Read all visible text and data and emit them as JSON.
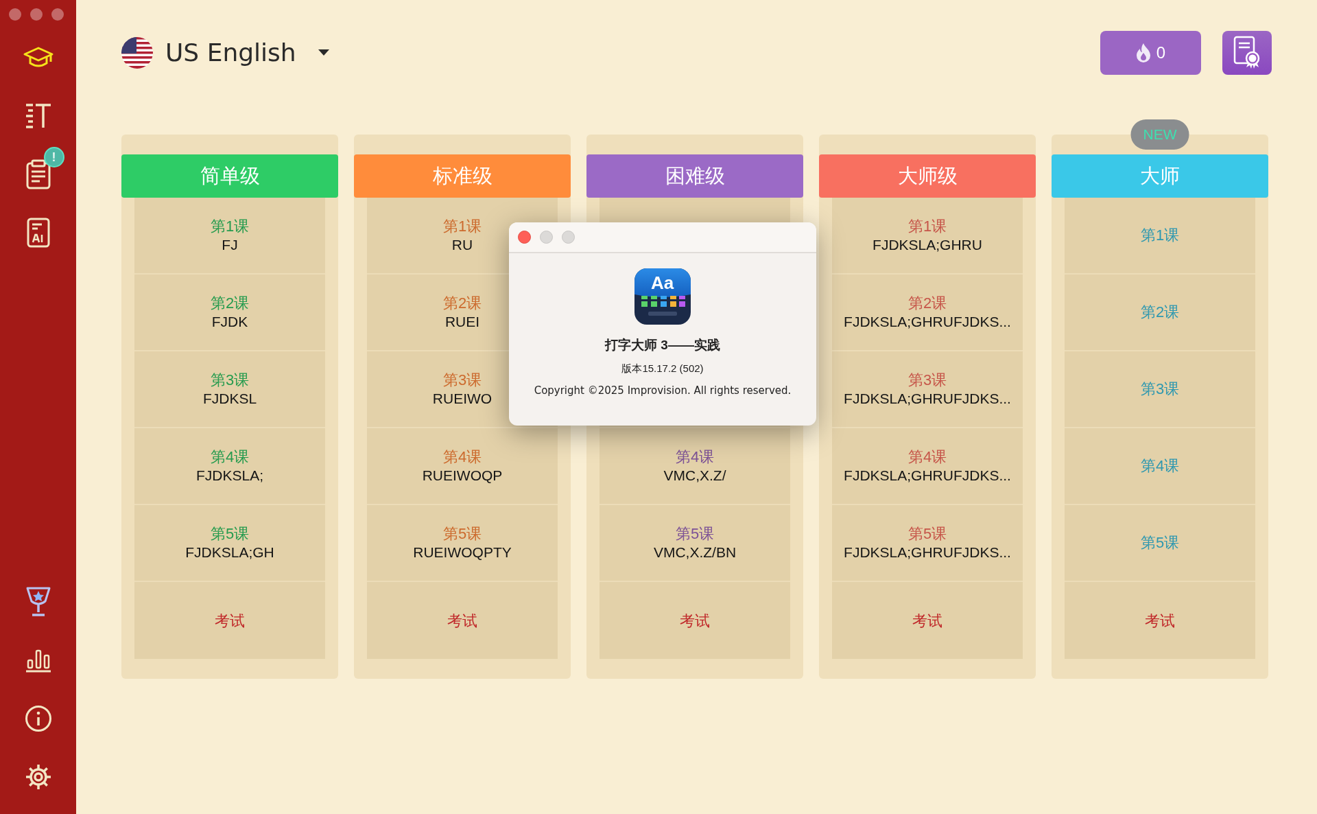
{
  "sidebar": {
    "items": [
      {
        "selected": true
      },
      {
        "selected": false
      },
      {
        "selected": false,
        "badge": "!"
      },
      {
        "selected": false
      },
      {
        "selected": false
      },
      {
        "selected": false
      },
      {
        "selected": false
      },
      {
        "selected": false
      }
    ]
  },
  "language": {
    "label": "US English"
  },
  "streak": {
    "count": "0"
  },
  "levels": [
    {
      "title": "简单级",
      "color": "#2ecc66",
      "lessons": [
        {
          "title": "第1课",
          "keys": "FJ"
        },
        {
          "title": "第2课",
          "keys": "FJDK"
        },
        {
          "title": "第3课",
          "keys": "FJDKSL"
        },
        {
          "title": "第4课",
          "keys": "FJDKSLA;"
        },
        {
          "title": "第5课",
          "keys": "FJDKSLA;GH"
        }
      ],
      "exam": "考试"
    },
    {
      "title": "标准级",
      "color": "#ff8c3b",
      "lessons": [
        {
          "title": "第1课",
          "keys": "RU"
        },
        {
          "title": "第2课",
          "keys": "RUEI"
        },
        {
          "title": "第3课",
          "keys": "RUEIWO"
        },
        {
          "title": "第4课",
          "keys": "RUEIWOQP"
        },
        {
          "title": "第5课",
          "keys": "RUEIWOQPTY"
        }
      ],
      "exam": "考试"
    },
    {
      "title": "困难级",
      "color": "#9b6ac6",
      "lessons": [
        {
          "covered": true
        },
        {
          "title": "第4课",
          "keys": "VMC,X.Z/"
        },
        {
          "title": "第5课",
          "keys": "VMC,X.Z/BN"
        }
      ],
      "exam": "考试"
    },
    {
      "title": "大师级",
      "color": "#f87060",
      "lessons": [
        {
          "title": "第1课",
          "keys": "FJDKSLA;GHRU"
        },
        {
          "title": "第2课",
          "keys": "FJDKSLA;GHRUFJDKS..."
        },
        {
          "title": "第3课",
          "keys": "FJDKSLA;GHRUFJDKS..."
        },
        {
          "title": "第4课",
          "keys": "FJDKSLA;GHRUFJDKS..."
        },
        {
          "title": "第5课",
          "keys": "FJDKSLA;GHRUFJDKS..."
        }
      ],
      "exam": "考试"
    },
    {
      "title": "大师",
      "color": "#3ac8e8",
      "badge": "NEW",
      "lessons": [
        {
          "title": "第1课"
        },
        {
          "title": "第2课"
        },
        {
          "title": "第3课"
        },
        {
          "title": "第4课"
        },
        {
          "title": "第5课"
        }
      ],
      "exam": "考试"
    }
  ],
  "dialog": {
    "icon_text": "Aa",
    "app_name": "打字大师 3——实践",
    "version": "版本15.17.2 (502)",
    "copyright": "Copyright ©2025 Improvision. All rights reserved."
  }
}
